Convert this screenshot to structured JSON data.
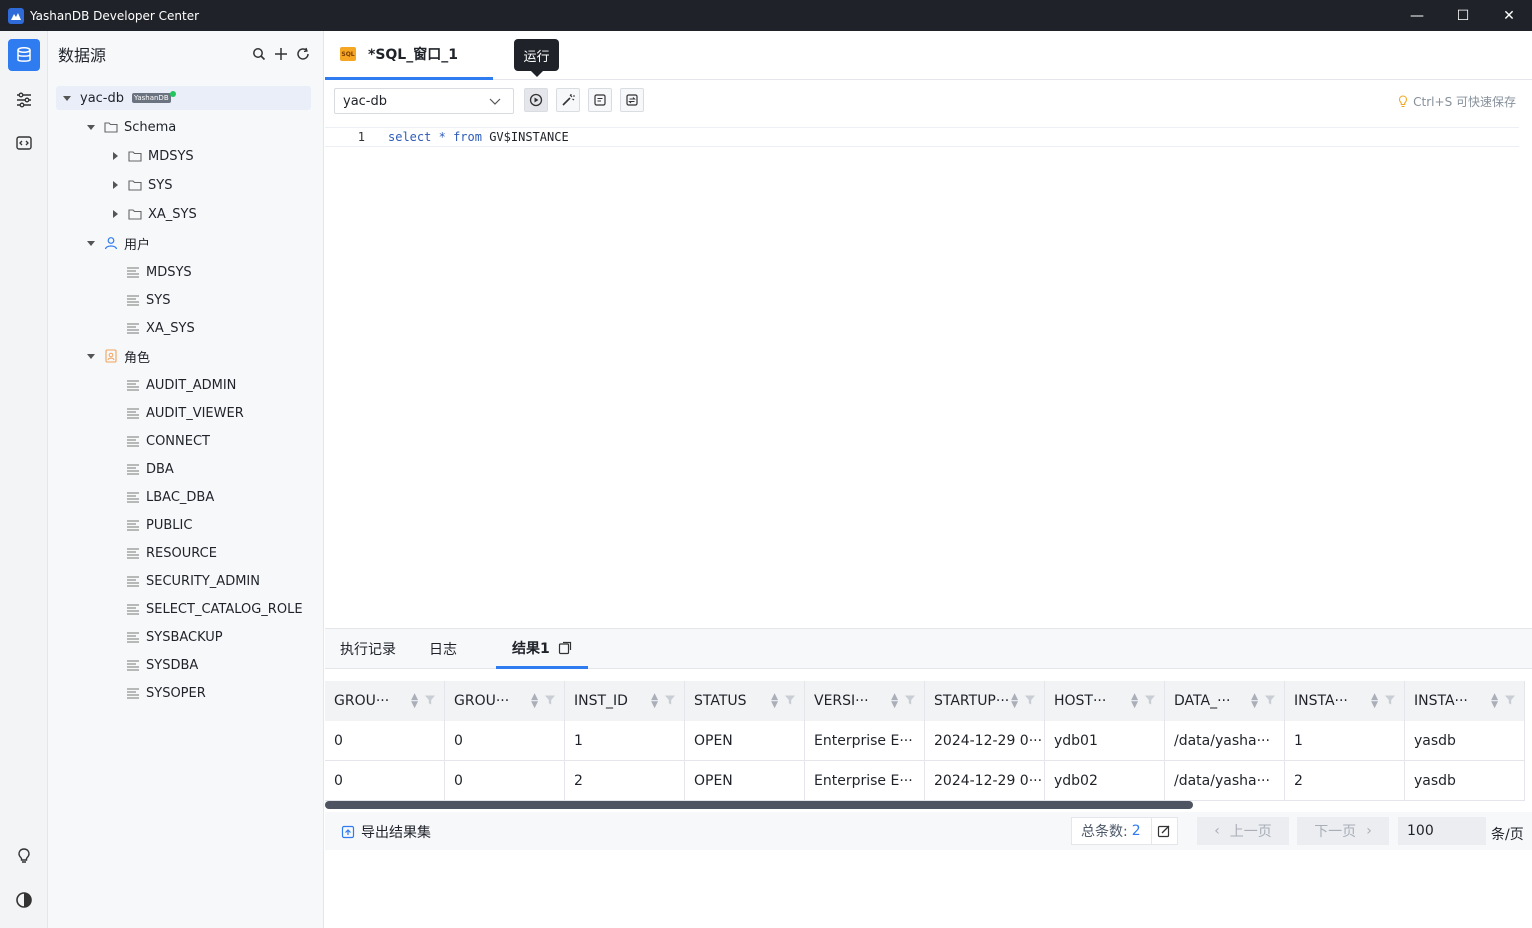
{
  "window": {
    "title": "YashanDB Developer Center",
    "minimize": "—",
    "maximize": "☐",
    "close": "✕"
  },
  "sidebar": {
    "title": "数据源",
    "tree": {
      "root": {
        "label": "yac-db",
        "badge": "YashanDB"
      },
      "schema_folder": "Schema",
      "schemas": [
        "MDSYS",
        "SYS",
        "XA_SYS"
      ],
      "users_folder": "用户",
      "users": [
        "MDSYS",
        "SYS",
        "XA_SYS"
      ],
      "roles_folder": "角色",
      "roles": [
        "AUDIT_ADMIN",
        "AUDIT_VIEWER",
        "CONNECT",
        "DBA",
        "LBAC_DBA",
        "PUBLIC",
        "RESOURCE",
        "SECURITY_ADMIN",
        "SELECT_CATALOG_ROLE",
        "SYSBACKUP",
        "SYSDBA",
        "SYSOPER"
      ]
    }
  },
  "editor": {
    "tab_label": "*SQL_窗口_1",
    "tab_icon_text": "SQL",
    "tooltip": "运行",
    "db_select_value": "yac-db",
    "hint": "Ctrl+S 可快速保存",
    "line_number": "1",
    "code": {
      "kw1": "select",
      "star": "*",
      "kw2": "from",
      "table": "GV$INSTANCE"
    }
  },
  "results": {
    "tabs": {
      "history": "执行记录",
      "log": "日志",
      "result": "结果1"
    },
    "columns": [
      "GROU···",
      "GROU···",
      "INST_ID",
      "STATUS",
      "VERSI···",
      "STARTUP···",
      "HOST···",
      "DATA_···",
      "INSTA···",
      "INSTA···"
    ],
    "rows": [
      [
        "0",
        "0",
        "1",
        "OPEN",
        "Enterprise E···",
        "2024-12-29 0···",
        "ydb01",
        "/data/yasha···",
        "1",
        "yasdb"
      ],
      [
        "0",
        "0",
        "2",
        "OPEN",
        "Enterprise E···",
        "2024-12-29 0···",
        "ydb02",
        "/data/yasha···",
        "2",
        "yasdb"
      ]
    ],
    "export_label": "导出结果集",
    "total_label": "总条数:",
    "total_count": "2",
    "prev_label": "上一页",
    "next_label": "下一页",
    "page_size": "100",
    "per_page_label": "条/页"
  },
  "colors": {
    "accent": "#2f7bf0",
    "titlebar": "#1f2329",
    "sql_icon": "#f5a623"
  }
}
